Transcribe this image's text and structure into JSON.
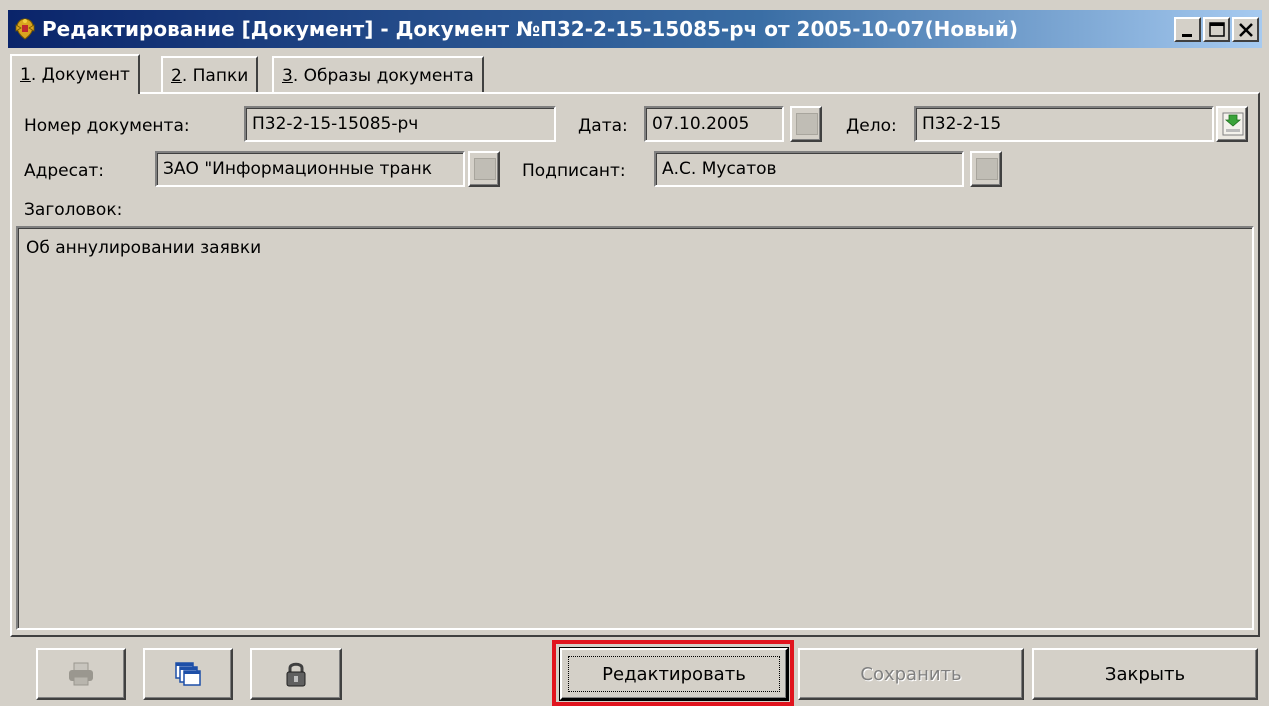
{
  "window": {
    "title": "Редактирование [Документ] - Документ №П32-2-15-15085-рч от 2005-10-07(Новый)",
    "accent_color": "#0a246a"
  },
  "tabs": [
    {
      "hotkey": "1",
      "label": ". Документ"
    },
    {
      "hotkey": "2",
      "label": ". Папки"
    },
    {
      "hotkey": "3",
      "label": ". Образы документа"
    }
  ],
  "form": {
    "doc_number_label": "Номер документа:",
    "doc_number_value": "П32-2-15-15085-рч",
    "date_label": "Дата:",
    "date_value": "07.10.2005",
    "case_label": "Дело:",
    "case_value": "П32-2-15",
    "addressee_label": "Адресат:",
    "addressee_value": "ЗАО \"Информационные транк",
    "signer_label": "Подписант:",
    "signer_value": "А.С. Мусатов",
    "heading_label": "Заголовок:",
    "heading_value": "Об аннулировании заявки"
  },
  "buttons": {
    "print_icon": "printer-icon",
    "copy_icon": "windows-icon",
    "sign_icon": "lock-icon",
    "edit_label": "Редактировать",
    "save_label": "Сохранить",
    "close_label": "Закрыть"
  },
  "highlight_color": "#e0141e"
}
